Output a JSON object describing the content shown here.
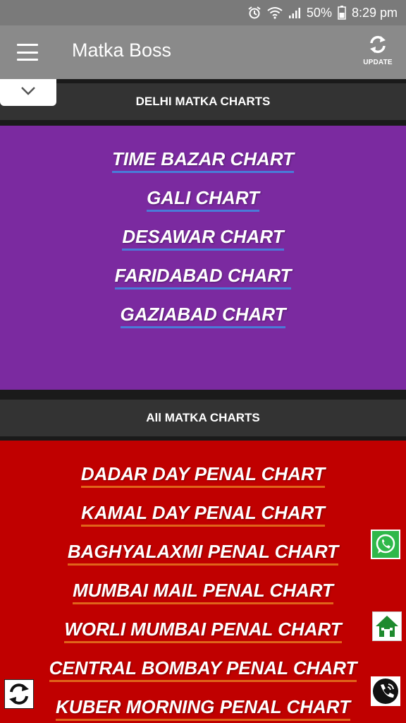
{
  "status_bar": {
    "battery_text": "50%",
    "time": "8:29 pm",
    "icons": [
      "alarm-icon",
      "wifi-icon",
      "signal-icon",
      "battery-icon"
    ]
  },
  "app_bar": {
    "title": "Matka Boss",
    "update_label": "UPDATE",
    "icons": [
      "menu-icon",
      "refresh-icon"
    ]
  },
  "sections": {
    "delhi": {
      "header": "DELHI MATKA CHARTS",
      "links": [
        "TIME BAZAR CHART",
        "GALI CHART",
        "DESAWAR CHART",
        "FARIDABAD CHART",
        "GAZIABAD CHART"
      ]
    },
    "all": {
      "header": "All MATKA CHARTS",
      "links": [
        "DADAR DAY PENAL CHART",
        "KAMAL DAY PENAL CHART",
        "BAGHYALAXMI PENAL CHART",
        "MUMBAI MAIL PENAL CHART",
        "WORLI MUMBAI PENAL CHART",
        "CENTRAL BOMBAY PENAL CHART",
        "KUBER MORNING PENAL CHART"
      ]
    }
  },
  "floating_icons": [
    "whatsapp-icon",
    "home-icon",
    "phone-icon",
    "refresh-icon"
  ],
  "colors": {
    "status_bar": "#7a7a7a",
    "app_bar": "#8a8a8a",
    "section_header": "#333333",
    "purple_panel": "#7b2aa0",
    "red_panel": "#c00000",
    "purple_underline": "#4a7bd8",
    "red_underline": "#e0641a",
    "whatsapp": "#2fb84a",
    "home": "#1e8a2e"
  }
}
